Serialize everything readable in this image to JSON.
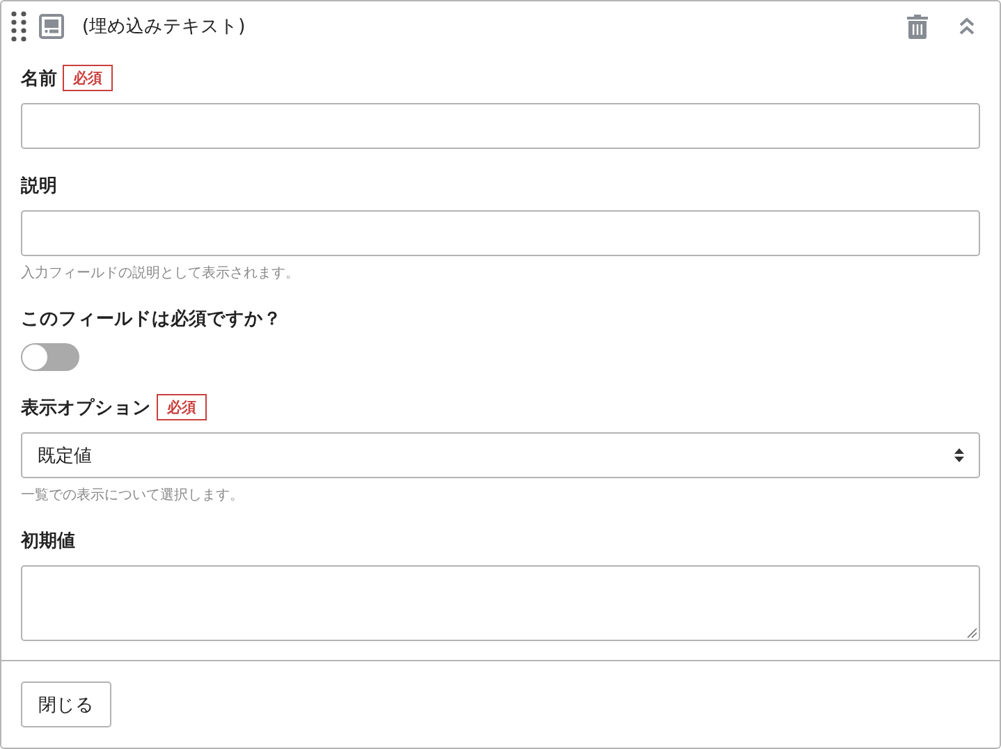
{
  "header": {
    "title": "(埋め込みテキスト)"
  },
  "fields": [
    {
      "kind": "text",
      "label": "名前",
      "required_badge": "必須"
    },
    {
      "kind": "text",
      "label": "説明",
      "help": "入力フィールドの説明として表示されます。"
    },
    {
      "kind": "toggle",
      "label": "このフィールドは必須ですか？",
      "on": false
    },
    {
      "kind": "select",
      "label": "表示オプション",
      "required_badge": "必須",
      "value": "既定値",
      "help": "一覧での表示について選択します。"
    },
    {
      "kind": "textarea",
      "label": "初期値"
    }
  ],
  "footer": {
    "close_button": "閉じる"
  }
}
